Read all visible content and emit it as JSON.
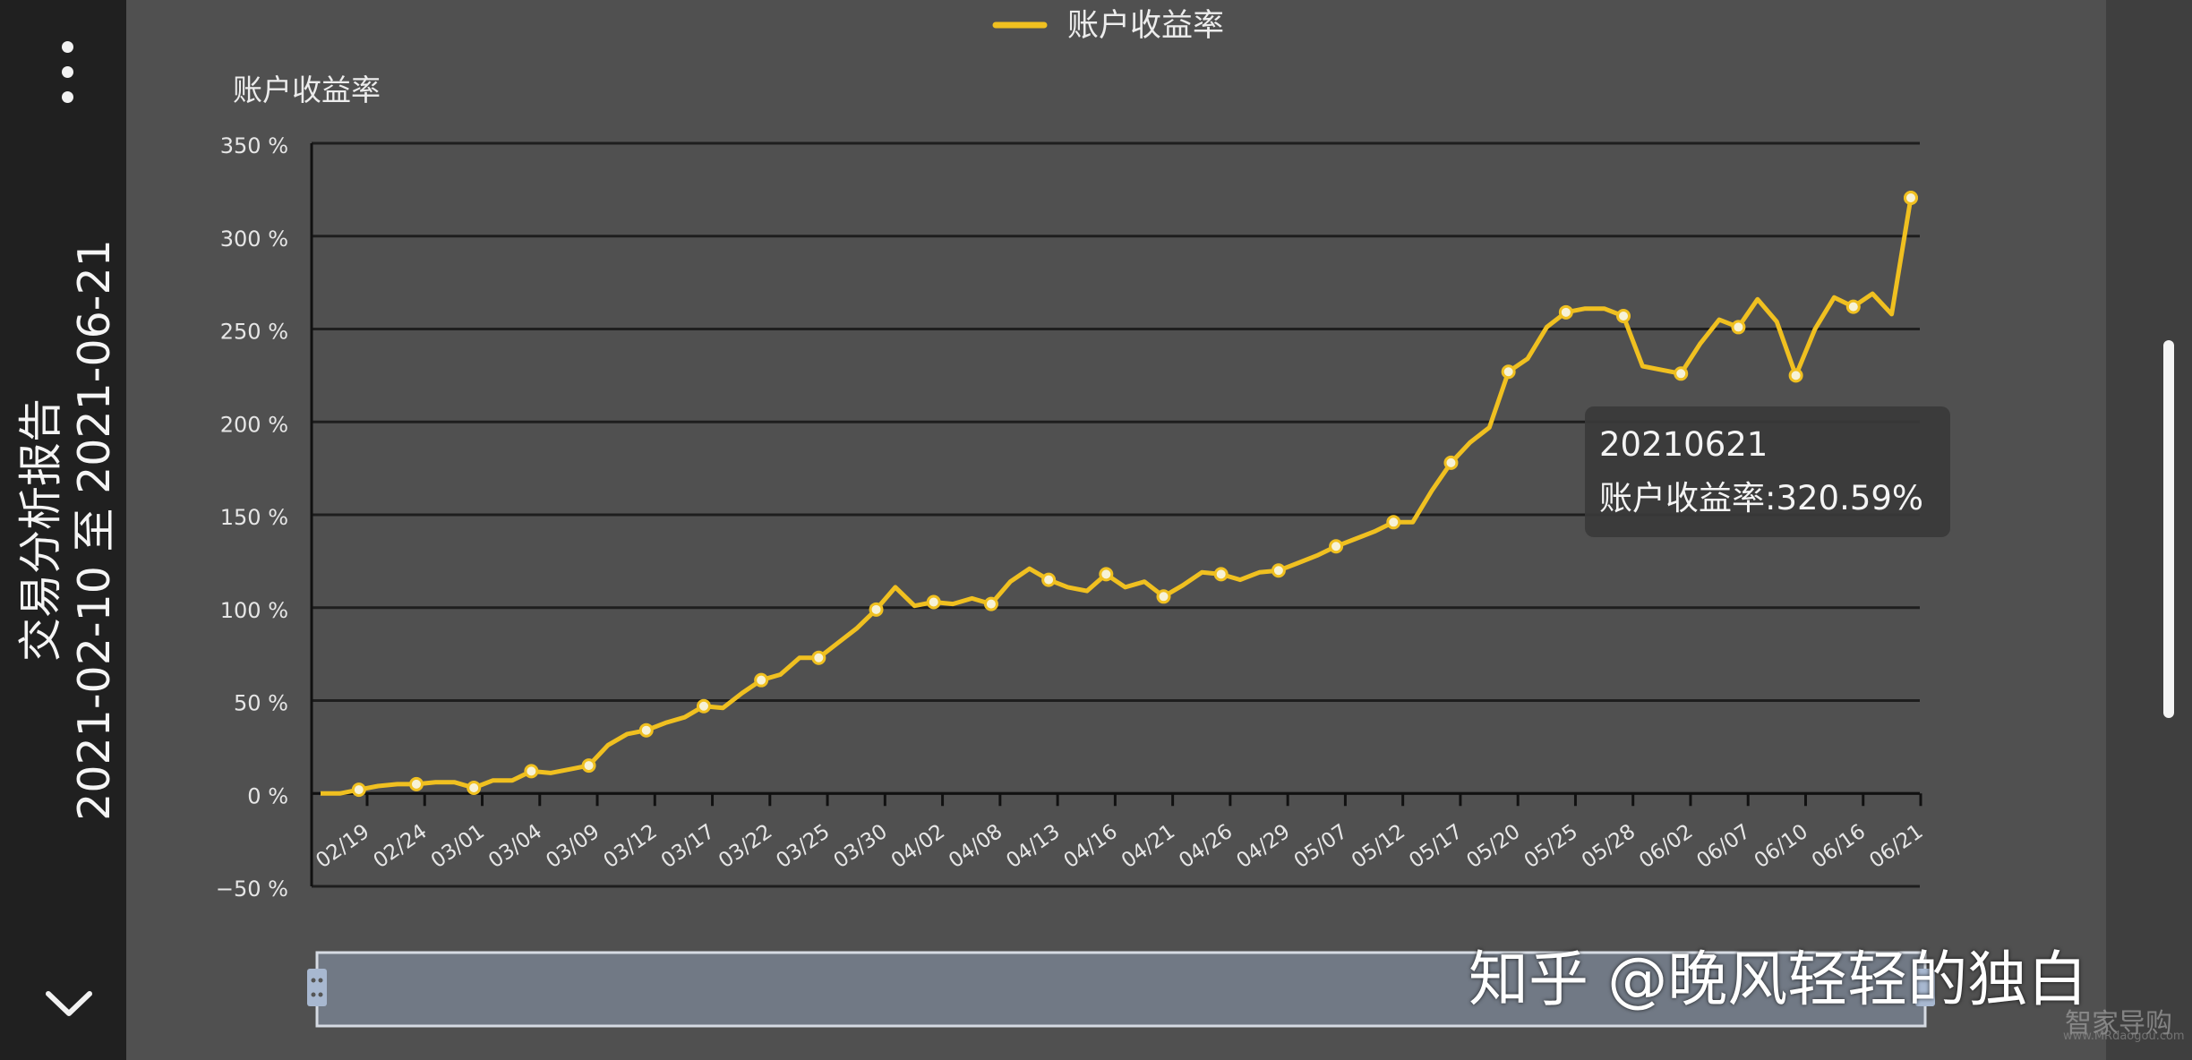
{
  "report": {
    "title_line1": "交易分析报告",
    "title_line2": "2021-02-10 至 2021-06-21"
  },
  "icons": {
    "menu": "more-vertical-icon",
    "collapse": "chevron-down-icon"
  },
  "colors": {
    "line": "#f0c020",
    "background": "#505050",
    "grid": "#1e1e1e"
  },
  "chart_data": {
    "type": "line",
    "legend": {
      "label": "账户收益率",
      "position": "top-center"
    },
    "ylabel": "账户收益率",
    "ylim": [
      -50,
      350
    ],
    "yticks": [
      -50,
      0,
      50,
      100,
      150,
      200,
      250,
      300,
      350
    ],
    "ytick_labels": [
      "−50 %",
      "0 %",
      "50 %",
      "100 %",
      "150 %",
      "200 %",
      "250 %",
      "300 %",
      "350 %"
    ],
    "x_tick_labels": [
      "02/19",
      "02/24",
      "03/01",
      "03/04",
      "03/09",
      "03/12",
      "03/17",
      "03/22",
      "03/25",
      "03/30",
      "04/02",
      "04/08",
      "04/13",
      "04/16",
      "04/21",
      "04/26",
      "04/29",
      "05/07",
      "05/12",
      "05/17",
      "05/20",
      "05/25",
      "05/28",
      "06/02",
      "06/07",
      "06/10",
      "06/16",
      "06/21"
    ],
    "grid": true,
    "series": [
      {
        "name": "账户收益率",
        "values": [
          0,
          0,
          2,
          4,
          5,
          5,
          6,
          6,
          3,
          7,
          7,
          12,
          11,
          13,
          15,
          26,
          32,
          34,
          38,
          41,
          47,
          46,
          54,
          61,
          64,
          73,
          73,
          81,
          89,
          99,
          111,
          101,
          103,
          102,
          105,
          102,
          114,
          121,
          115,
          111,
          109,
          118,
          111,
          114,
          106,
          112,
          119,
          118,
          115,
          119,
          120,
          124,
          128,
          133,
          137,
          141,
          146,
          146,
          163,
          178,
          189,
          197,
          227,
          234,
          251,
          259,
          261,
          261,
          257,
          230,
          228,
          226,
          242,
          255,
          251,
          266,
          254,
          225,
          250,
          267,
          262,
          269,
          258,
          320.59
        ]
      }
    ],
    "tooltip": {
      "date": "20210621",
      "text": "账户收益率:320.59%"
    }
  },
  "watermark": {
    "text": "知乎 @晚风轻轻的独白",
    "logo": "智家导购",
    "url": "www.MRdaogou.com"
  }
}
